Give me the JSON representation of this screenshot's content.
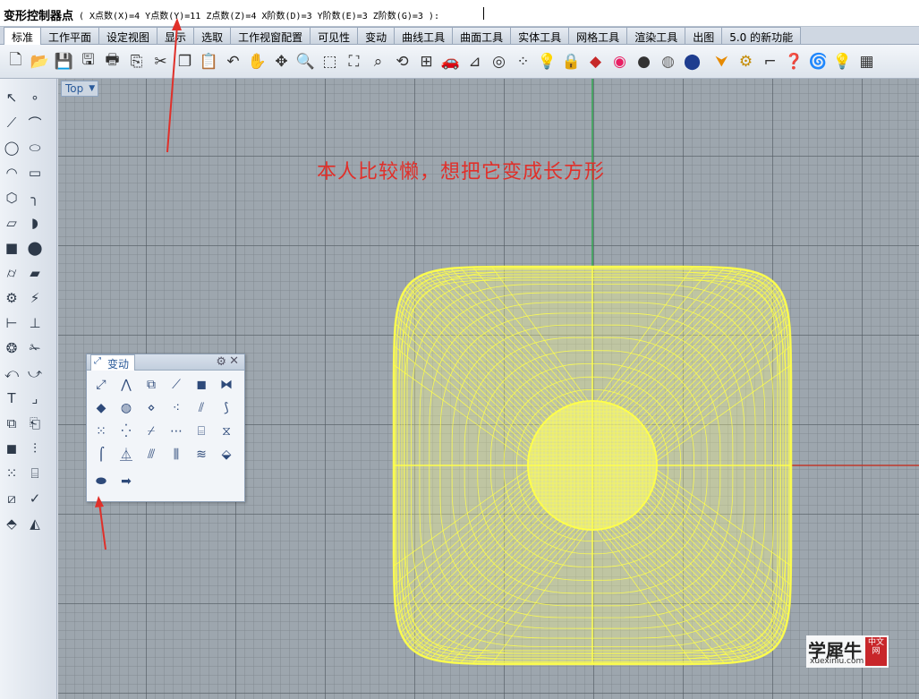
{
  "command": {
    "prompt": "变形控制器点",
    "params": "( X点数(X)=4  Y点数(Y)=11  Z点数(Z)=4  X阶数(D)=3  Y阶数(E)=3  Z阶数(G)=3 ):"
  },
  "tabs": [
    "标准",
    "工作平面",
    "设定视图",
    "显示",
    "选取",
    "工作视窗配置",
    "可见性",
    "变动",
    "曲线工具",
    "曲面工具",
    "实体工具",
    "网格工具",
    "渲染工具",
    "出图",
    "5.0 的新功能"
  ],
  "viewport": {
    "name": "Top",
    "annotation": "本人比较懒，想把它变成长方形"
  },
  "palette": {
    "title": "变动"
  },
  "watermark": {
    "name": "学犀牛",
    "url": "xuexiniu.com",
    "badge": "中文网"
  },
  "colors": {
    "wireframe": "#ffff4a",
    "annotation": "#e0302a",
    "x_axis": "#c0392b",
    "y_axis": "#2ea44f",
    "viewport_bg": "#9da6ae"
  }
}
